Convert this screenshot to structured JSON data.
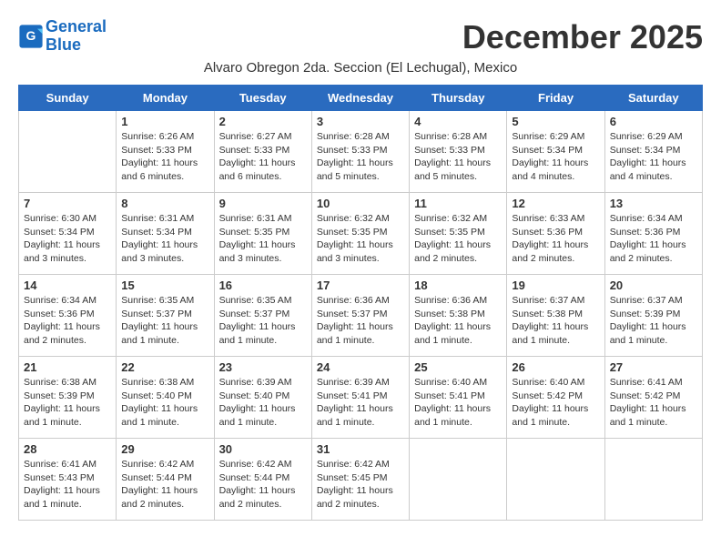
{
  "header": {
    "logo_line1": "General",
    "logo_line2": "Blue",
    "month_title": "December 2025",
    "subtitle": "Alvaro Obregon 2da. Seccion (El Lechugal), Mexico"
  },
  "days_of_week": [
    "Sunday",
    "Monday",
    "Tuesday",
    "Wednesday",
    "Thursday",
    "Friday",
    "Saturday"
  ],
  "weeks": [
    [
      {
        "day": "",
        "info": ""
      },
      {
        "day": "1",
        "info": "Sunrise: 6:26 AM\nSunset: 5:33 PM\nDaylight: 11 hours\nand 6 minutes."
      },
      {
        "day": "2",
        "info": "Sunrise: 6:27 AM\nSunset: 5:33 PM\nDaylight: 11 hours\nand 6 minutes."
      },
      {
        "day": "3",
        "info": "Sunrise: 6:28 AM\nSunset: 5:33 PM\nDaylight: 11 hours\nand 5 minutes."
      },
      {
        "day": "4",
        "info": "Sunrise: 6:28 AM\nSunset: 5:33 PM\nDaylight: 11 hours\nand 5 minutes."
      },
      {
        "day": "5",
        "info": "Sunrise: 6:29 AM\nSunset: 5:34 PM\nDaylight: 11 hours\nand 4 minutes."
      },
      {
        "day": "6",
        "info": "Sunrise: 6:29 AM\nSunset: 5:34 PM\nDaylight: 11 hours\nand 4 minutes."
      }
    ],
    [
      {
        "day": "7",
        "info": "Sunrise: 6:30 AM\nSunset: 5:34 PM\nDaylight: 11 hours\nand 3 minutes."
      },
      {
        "day": "8",
        "info": "Sunrise: 6:31 AM\nSunset: 5:34 PM\nDaylight: 11 hours\nand 3 minutes."
      },
      {
        "day": "9",
        "info": "Sunrise: 6:31 AM\nSunset: 5:35 PM\nDaylight: 11 hours\nand 3 minutes."
      },
      {
        "day": "10",
        "info": "Sunrise: 6:32 AM\nSunset: 5:35 PM\nDaylight: 11 hours\nand 3 minutes."
      },
      {
        "day": "11",
        "info": "Sunrise: 6:32 AM\nSunset: 5:35 PM\nDaylight: 11 hours\nand 2 minutes."
      },
      {
        "day": "12",
        "info": "Sunrise: 6:33 AM\nSunset: 5:36 PM\nDaylight: 11 hours\nand 2 minutes."
      },
      {
        "day": "13",
        "info": "Sunrise: 6:34 AM\nSunset: 5:36 PM\nDaylight: 11 hours\nand 2 minutes."
      }
    ],
    [
      {
        "day": "14",
        "info": "Sunrise: 6:34 AM\nSunset: 5:36 PM\nDaylight: 11 hours\nand 2 minutes."
      },
      {
        "day": "15",
        "info": "Sunrise: 6:35 AM\nSunset: 5:37 PM\nDaylight: 11 hours\nand 1 minute."
      },
      {
        "day": "16",
        "info": "Sunrise: 6:35 AM\nSunset: 5:37 PM\nDaylight: 11 hours\nand 1 minute."
      },
      {
        "day": "17",
        "info": "Sunrise: 6:36 AM\nSunset: 5:37 PM\nDaylight: 11 hours\nand 1 minute."
      },
      {
        "day": "18",
        "info": "Sunrise: 6:36 AM\nSunset: 5:38 PM\nDaylight: 11 hours\nand 1 minute."
      },
      {
        "day": "19",
        "info": "Sunrise: 6:37 AM\nSunset: 5:38 PM\nDaylight: 11 hours\nand 1 minute."
      },
      {
        "day": "20",
        "info": "Sunrise: 6:37 AM\nSunset: 5:39 PM\nDaylight: 11 hours\nand 1 minute."
      }
    ],
    [
      {
        "day": "21",
        "info": "Sunrise: 6:38 AM\nSunset: 5:39 PM\nDaylight: 11 hours\nand 1 minute."
      },
      {
        "day": "22",
        "info": "Sunrise: 6:38 AM\nSunset: 5:40 PM\nDaylight: 11 hours\nand 1 minute."
      },
      {
        "day": "23",
        "info": "Sunrise: 6:39 AM\nSunset: 5:40 PM\nDaylight: 11 hours\nand 1 minute."
      },
      {
        "day": "24",
        "info": "Sunrise: 6:39 AM\nSunset: 5:41 PM\nDaylight: 11 hours\nand 1 minute."
      },
      {
        "day": "25",
        "info": "Sunrise: 6:40 AM\nSunset: 5:41 PM\nDaylight: 11 hours\nand 1 minute."
      },
      {
        "day": "26",
        "info": "Sunrise: 6:40 AM\nSunset: 5:42 PM\nDaylight: 11 hours\nand 1 minute."
      },
      {
        "day": "27",
        "info": "Sunrise: 6:41 AM\nSunset: 5:42 PM\nDaylight: 11 hours\nand 1 minute."
      }
    ],
    [
      {
        "day": "28",
        "info": "Sunrise: 6:41 AM\nSunset: 5:43 PM\nDaylight: 11 hours\nand 1 minute."
      },
      {
        "day": "29",
        "info": "Sunrise: 6:42 AM\nSunset: 5:44 PM\nDaylight: 11 hours\nand 2 minutes."
      },
      {
        "day": "30",
        "info": "Sunrise: 6:42 AM\nSunset: 5:44 PM\nDaylight: 11 hours\nand 2 minutes."
      },
      {
        "day": "31",
        "info": "Sunrise: 6:42 AM\nSunset: 5:45 PM\nDaylight: 11 hours\nand 2 minutes."
      },
      {
        "day": "",
        "info": ""
      },
      {
        "day": "",
        "info": ""
      },
      {
        "day": "",
        "info": ""
      }
    ]
  ]
}
